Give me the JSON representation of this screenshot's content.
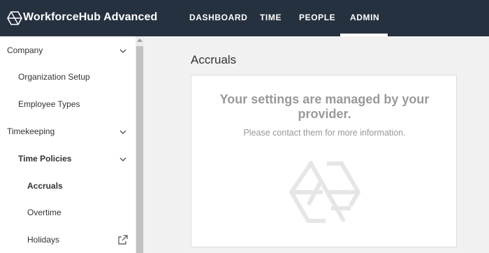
{
  "header": {
    "brand": "WorkforceHub Advanced",
    "logo_icon": "hexagon-logo-icon",
    "nav": [
      {
        "label": "DASHBOARD",
        "active": false
      },
      {
        "label": "TIME",
        "active": false
      },
      {
        "label": "PEOPLE",
        "active": false
      },
      {
        "label": "ADMIN",
        "active": true
      }
    ]
  },
  "sidebar": {
    "items": [
      {
        "label": "Company",
        "level": 0,
        "icon": "chevron-down-icon"
      },
      {
        "label": "Organization Setup",
        "level": 1
      },
      {
        "label": "Employee Types",
        "level": 1
      },
      {
        "label": "Timekeeping",
        "level": 0,
        "icon": "chevron-down-icon"
      },
      {
        "label": "Time Policies",
        "level": 1,
        "bold": true,
        "icon": "chevron-down-icon"
      },
      {
        "label": "Accruals",
        "level": 2,
        "bold": true,
        "selected": true
      },
      {
        "label": "Overtime",
        "level": 2
      },
      {
        "label": "Holidays",
        "level": 2,
        "icon": "external-link-icon"
      }
    ]
  },
  "main": {
    "title": "Accruals",
    "card": {
      "heading": "Your settings are managed by your provider.",
      "heading_line1": "Your settings are managed by your",
      "heading_line2": "provider.",
      "subtext": "Please contact them for more information.",
      "watermark_icon": "hexagon-logo-icon"
    }
  },
  "colors": {
    "header_bg": "#263140",
    "text_dark": "#333333",
    "muted_text": "#999999",
    "page_bg": "#f1f1f1"
  }
}
